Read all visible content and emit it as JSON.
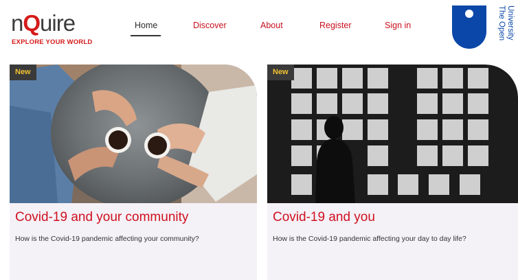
{
  "brand": {
    "name_pre": "n",
    "name_q": "Q",
    "name_post": "uire",
    "tagline": "EXPLORE YOUR WORLD",
    "accent": "#d51a1a"
  },
  "nav": {
    "items": [
      {
        "label": "Home",
        "active": true
      },
      {
        "label": "Discover",
        "active": false
      },
      {
        "label": "About",
        "active": false
      },
      {
        "label": "Register",
        "active": false
      },
      {
        "label": "Sign in",
        "active": false
      }
    ]
  },
  "partner": {
    "name": "The Open University",
    "line1": "The Open",
    "line2": "University",
    "color": "#0a47a8"
  },
  "cards": [
    {
      "badge": "New",
      "title": "Covid-19 and your community",
      "description": "How is the Covid-19 pandemic affecting your community?",
      "image": "coffee-table-photo"
    },
    {
      "badge": "New",
      "title": "Covid-19 and you",
      "description": "How is the Covid-19 pandemic affecting your day to day life?",
      "image": "window-silhouette-photo"
    }
  ]
}
